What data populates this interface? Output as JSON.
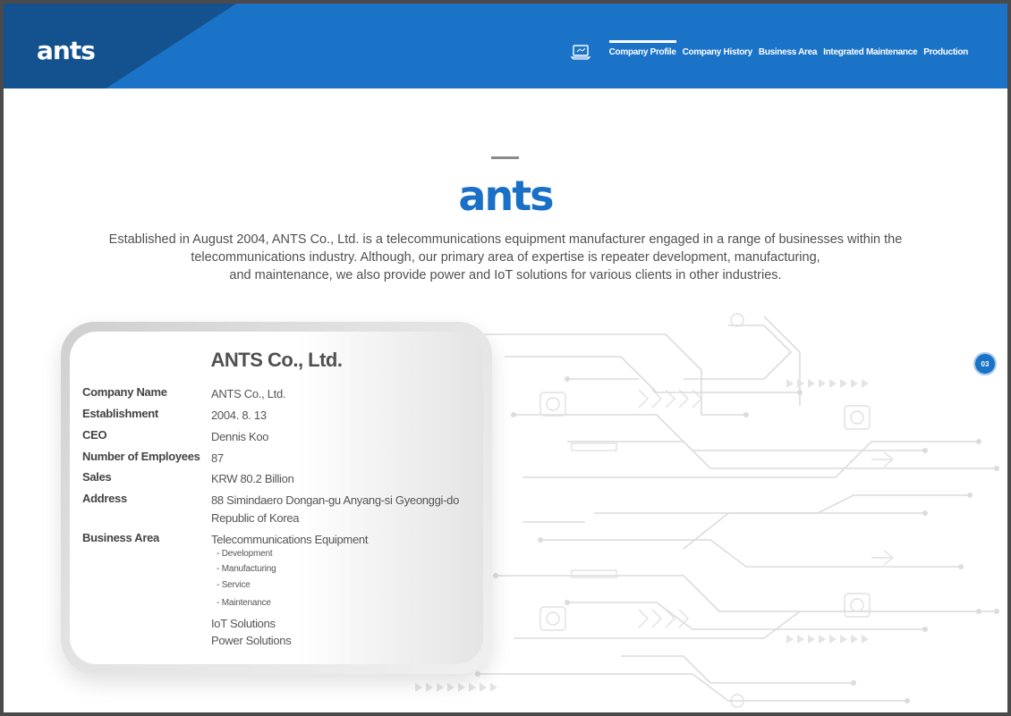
{
  "header": {
    "logo": "ants",
    "nav": [
      {
        "label": "Company Profile",
        "active": true
      },
      {
        "label": "Company History",
        "active": false
      },
      {
        "label": "Business Area",
        "active": false
      },
      {
        "label": "Integrated Maintenance",
        "active": false
      },
      {
        "label": "Production",
        "active": false
      }
    ]
  },
  "intro": {
    "logo": "ants",
    "lines": [
      "Established in August 2004, ANTS Co., Ltd. is a telecommunications equipment manufacturer engaged in a range of businesses within the",
      "telecommunications industry. Although, our primary area of expertise is repeater development, manufacturing,",
      "and maintenance, we also provide power and IoT solutions for various clients in other industries."
    ]
  },
  "page_number": "03",
  "card": {
    "title": "ANTS Co., Ltd.",
    "rows": [
      {
        "key": "Company Name",
        "value": "ANTS Co., Ltd."
      },
      {
        "key": "Establishment",
        "value": "2004. 8. 13"
      },
      {
        "key": "CEO",
        "value": "Dennis Koo"
      },
      {
        "key": "Number of Employees",
        "value": "87"
      },
      {
        "key": "Sales",
        "value": "KRW 80.2 Billion"
      },
      {
        "key": "Address",
        "value": "88 Simindaero Dongan-gu Anyang-si Gyeonggi-do",
        "value2": "Republic of Korea"
      },
      {
        "key": "Business Area",
        "value": "Telecommunications Equipment"
      }
    ],
    "sub_items": [
      "- Development",
      "- Manufacturing",
      "- Service",
      "- Maintenance"
    ],
    "extra_items": [
      "IoT Solutions",
      "Power Solutions"
    ]
  },
  "colors": {
    "brand": "#1a73c7",
    "brand_dark": "#13528f"
  }
}
